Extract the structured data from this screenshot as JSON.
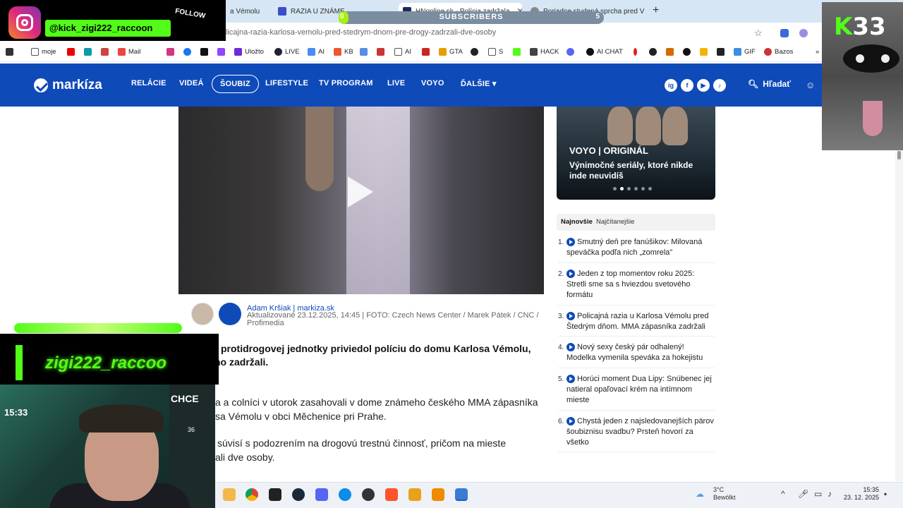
{
  "browser": {
    "tabs": [
      {
        "label": "a Vémolu"
      },
      {
        "label": "RAZIA U ZNÁME"
      },
      {
        "label": "HNonline.sk - Polícia zadržala"
      },
      {
        "label": "Poriadne studená sprcha pred V"
      }
    ],
    "url": "licajna-razia-karlosa-vemolu-pred-stedrym-dnom-pre-drogy-zadrzali-dve-osoby",
    "bookmarks": [
      "moje",
      "Mail",
      "Uložto",
      "LIVE",
      "AI",
      "KB",
      "GTA",
      "S",
      "HACK",
      "AI CHAT",
      "GIF",
      "Bazos"
    ]
  },
  "site": {
    "logo": "markíza",
    "nav": [
      "RELÁCIE",
      "VIDEÁ",
      "ŠOUBIZ",
      "LIFESTYLE",
      "TV PROGRAM",
      "LIVE",
      "VOYO",
      "ĎALŠIE"
    ],
    "nav_more_caret": "▾",
    "social": [
      "ig",
      "f",
      "▶",
      "♪"
    ],
    "search_label": "Hľadať",
    "search_icon": "search-icon",
    "user_icon": "user-icon"
  },
  "article": {
    "author": "Adam Kršiak | markiza.sk",
    "meta": "Aktualizované 23.12.2025, 14:45 | FOTO: Czech News Center / Marek Pátek / CNC / Profimedia",
    "lead_1": "protidrogovej jednotky priviedol políciu do domu Karlosa Vémolu,",
    "lead_2": "ho zadržali.",
    "para_1a": "a a colníci v utorok zasahovali v dome známeho českého MMA zápasníka",
    "para_1b": "sa Vémolu v obci Měchenice pri Prahe.",
    "para_2a": "súvisí s podozrením na drogovú trestnú činnosť, pričom na mieste",
    "para_2b": "ali dve osoby."
  },
  "sidebar": {
    "voyo_title": "VOYO | ORIGINÁL",
    "voyo_sub": "Výnimočné seriály, ktoré nikde inde neuvidíš",
    "tab_newest": "Najnovšie",
    "tab_most_read": "Najčítanejšie",
    "news": [
      {
        "num": "1.",
        "text": "Smutný deň pre fanúšikov: Milovaná speváčka podľa nich „zomrela\""
      },
      {
        "num": "2.",
        "text": "Jeden z top momentov roku 2025: Stretli sme sa s hviezdou svetového formátu"
      },
      {
        "num": "3.",
        "text": "Policajná razia u Karlosa Vémolu pred Štedrým dňom. MMA zápasníka zadržali"
      },
      {
        "num": "4.",
        "text": "Nový sexy český pár odhalený! Modelka vymenila speváka za hokejistu"
      },
      {
        "num": "5.",
        "text": "Horúci moment Dua Lipy: Snúbenec jej natieral opaľovací krém na intímnom mieste"
      },
      {
        "num": "6.",
        "text": "Chystá jeden z najsledovanejších párov šoubiznisu svadbu? Prsteň hovorí za všetko"
      }
    ]
  },
  "stream": {
    "handle": "@kick_zigi222_raccoon",
    "follow": "FOLLOW",
    "subs_label": "SUBSCRIBERS",
    "subs_current": "0",
    "subs_goal": "5",
    "k33_k": "K",
    "k33_num": "33",
    "name": "zigi222_raccoo",
    "chce": "CHCE",
    "cam_time": "15:33",
    "cam_num": "36"
  },
  "taskbar": {
    "weather_temp": "3°C",
    "weather_desc": "Bewölkt",
    "time": "15:35",
    "date": "23. 12. 2025"
  }
}
